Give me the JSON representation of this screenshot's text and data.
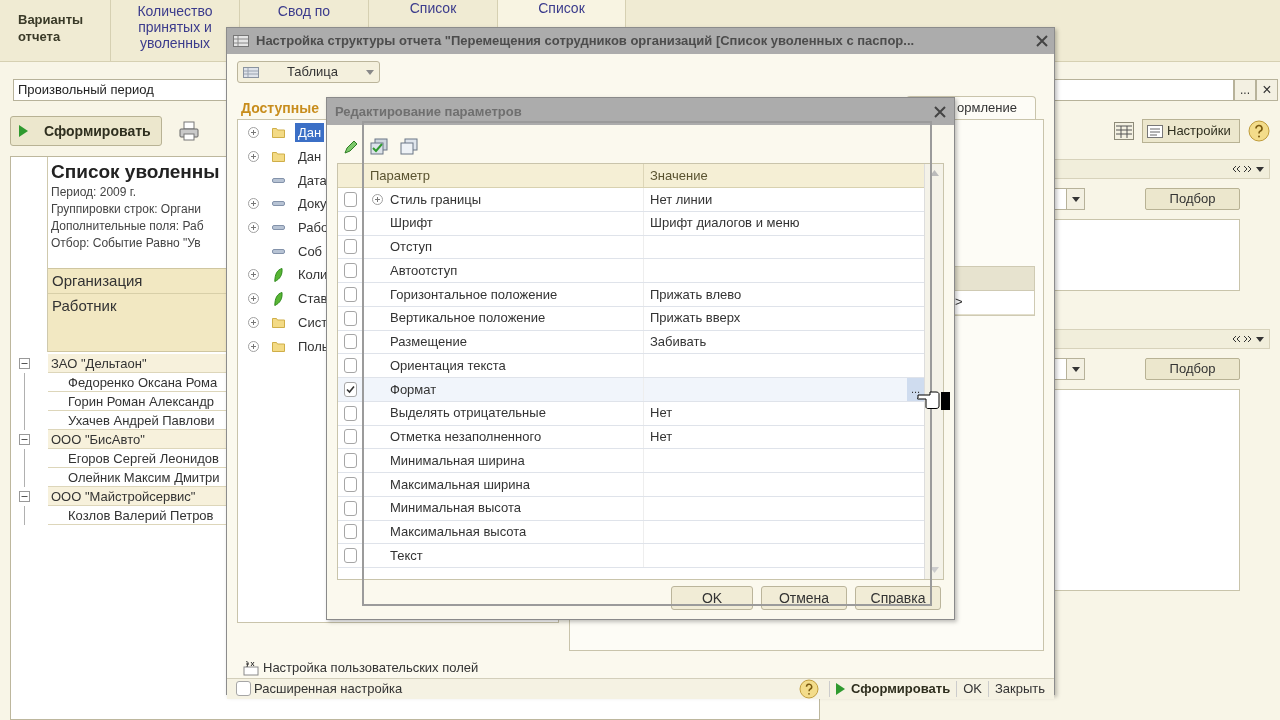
{
  "app": {
    "header_label": "Варианты отчета",
    "tabs": [
      {
        "label": "Количество принятых и уволенных",
        "selected": false
      },
      {
        "label": "Свод по",
        "selected": false
      },
      {
        "label": "Список",
        "selected": false
      },
      {
        "label": "Список",
        "selected": true
      }
    ],
    "period": {
      "value": "Произвольный период",
      "choice_button": "...",
      "clear_button": "×"
    },
    "toolbar": {
      "generate": "Сформировать",
      "settings": "Настройки"
    },
    "report": {
      "title": "Список уволенны",
      "info": [
        "Период: 2009 г.",
        "Группировки строк: Органи",
        "Дополнительные поля: Раб",
        "Отбор: Событие Равно \"Ув"
      ],
      "columns": [
        "Организация",
        "Работник"
      ],
      "groups": [
        {
          "name": "ЗАО \"Дельтаон\"",
          "expanded": true,
          "employees": [
            "Федоренко Оксана Рома",
            "Горин Роман Александр",
            "Ухачев Андрей Павлови"
          ]
        },
        {
          "name": "ООО \"БисАвто\"",
          "expanded": true,
          "employees": [
            "Егоров Сергей Леонидов",
            "Олейник Максим Дмитри"
          ]
        },
        {
          "name": "ООО \"Майстройсервис\"",
          "expanded": true,
          "employees": [
            "Козлов Валерий Петров"
          ]
        }
      ]
    },
    "selection_panels": [
      {
        "button": "Подбор"
      },
      {
        "button": "Подбор"
      }
    ]
  },
  "structure_dialog": {
    "title": "Настройка структуры отчета \"Перемещения сотрудников организаций [Список уволенных с паспор...",
    "view": "Таблица",
    "section": "Доступные",
    "fields": [
      {
        "label": "Дан",
        "kind": "folder",
        "expandable": true,
        "selected": true
      },
      {
        "label": "Дан",
        "kind": "folder",
        "expandable": true,
        "selected": false
      },
      {
        "label": "Дата",
        "kind": "field",
        "expandable": false,
        "selected": false
      },
      {
        "label": "Доку",
        "kind": "field",
        "expandable": true,
        "selected": false
      },
      {
        "label": "Рабо",
        "kind": "field",
        "expandable": true,
        "selected": false
      },
      {
        "label": "Соб",
        "kind": "field",
        "expandable": false,
        "selected": false
      },
      {
        "label": "Коли",
        "kind": "measure",
        "expandable": true,
        "selected": false
      },
      {
        "label": "Став",
        "kind": "measure",
        "expandable": true,
        "selected": false
      },
      {
        "label": "Сист",
        "kind": "folder",
        "expandable": true,
        "selected": false
      },
      {
        "label": "Поль",
        "kind": "folder",
        "expandable": true,
        "selected": false
      }
    ],
    "tab": "ормление",
    "row_marker": ">",
    "custom_fields_link": "Настройка пользовательских полей",
    "advanced": {
      "label": "Расширенная настройка",
      "checked": false
    },
    "buttons": {
      "generate": "Сформировать",
      "ok": "OK",
      "close": "Закрыть"
    }
  },
  "params_dialog": {
    "title": "Редактирование параметров",
    "columns": [
      "Параметр",
      "Значение"
    ],
    "choice_button": "...",
    "rows": [
      {
        "name": "Стиль границы",
        "value": "Нет линии",
        "checked": false,
        "expandable": true,
        "selected": false
      },
      {
        "name": "Шрифт",
        "value": "Шрифт диалогов и меню",
        "checked": false,
        "expandable": false,
        "selected": false
      },
      {
        "name": "Отступ",
        "value": "",
        "checked": false,
        "expandable": false,
        "selected": false
      },
      {
        "name": "Автоотступ",
        "value": "",
        "checked": false,
        "expandable": false,
        "selected": false
      },
      {
        "name": "Горизонтальное положение",
        "value": "Прижать влево",
        "checked": false,
        "expandable": false,
        "selected": false
      },
      {
        "name": "Вертикальное положение",
        "value": "Прижать вверх",
        "checked": false,
        "expandable": false,
        "selected": false
      },
      {
        "name": "Размещение",
        "value": "Забивать",
        "checked": false,
        "expandable": false,
        "selected": false
      },
      {
        "name": "Ориентация текста",
        "value": "",
        "checked": false,
        "expandable": false,
        "selected": false
      },
      {
        "name": "Формат",
        "value": "",
        "checked": true,
        "expandable": false,
        "selected": true
      },
      {
        "name": "Выделять отрицательные",
        "value": "Нет",
        "checked": false,
        "expandable": false,
        "selected": false
      },
      {
        "name": "Отметка незаполненного",
        "value": "Нет",
        "checked": false,
        "expandable": false,
        "selected": false
      },
      {
        "name": "Минимальная ширина",
        "value": "",
        "checked": false,
        "expandable": false,
        "selected": false
      },
      {
        "name": "Максимальная ширина",
        "value": "",
        "checked": false,
        "expandable": false,
        "selected": false
      },
      {
        "name": "Минимальная высота",
        "value": "",
        "checked": false,
        "expandable": false,
        "selected": false
      },
      {
        "name": "Максимальная высота",
        "value": "",
        "checked": false,
        "expandable": false,
        "selected": false
      },
      {
        "name": "Текст",
        "value": "",
        "checked": false,
        "expandable": false,
        "selected": false
      }
    ],
    "buttons": [
      "OK",
      "Отмена",
      "Справка"
    ]
  }
}
